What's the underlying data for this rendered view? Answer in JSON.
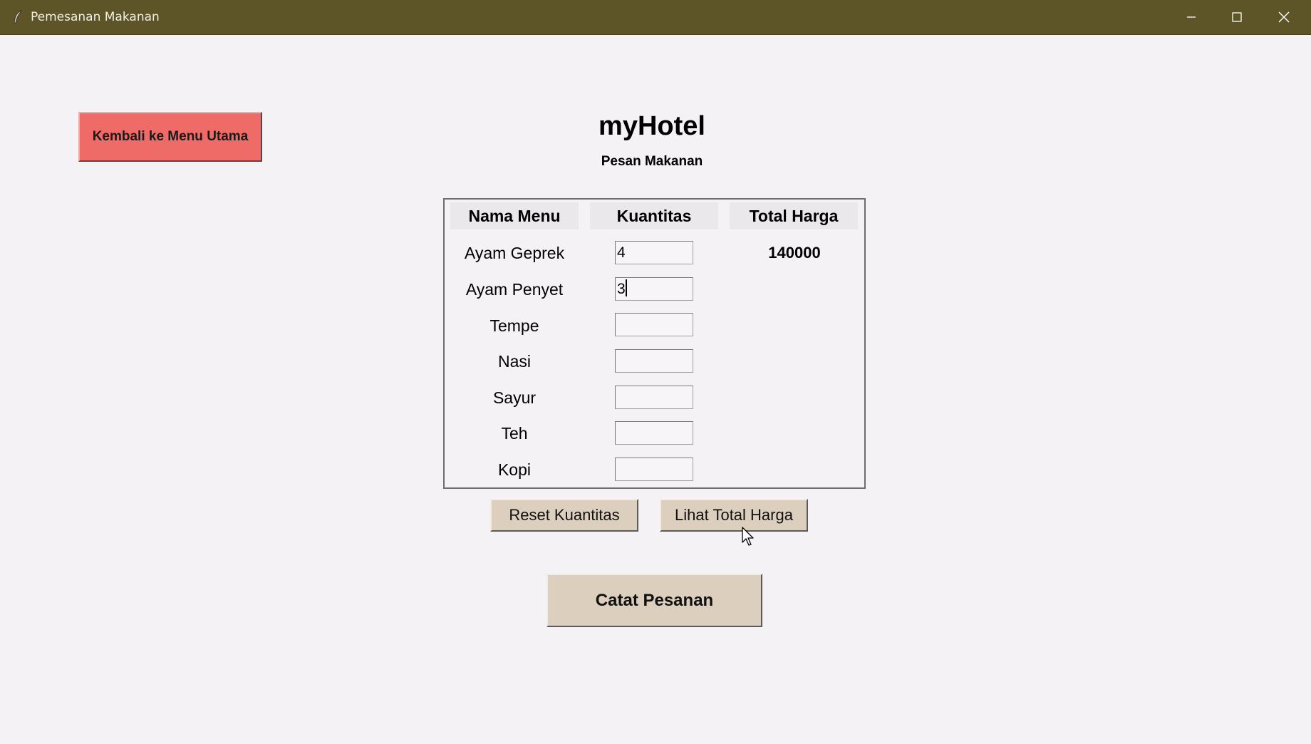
{
  "window": {
    "title": "Pemesanan Makanan",
    "controls": [
      "minimize",
      "maximize",
      "close"
    ],
    "titlebar_color": "#5d5428",
    "icon": "feather-icon"
  },
  "header": {
    "back_button": "Kembali ke Menu Utama",
    "title": "myHotel",
    "subtitle": "Pesan Makanan"
  },
  "order_table": {
    "columns": [
      "Nama Menu",
      "Kuantitas",
      "Total Harga"
    ],
    "rows": [
      {
        "name": "Ayam Geprek",
        "quantity": "4",
        "total": "140000"
      },
      {
        "name": "Ayam Penyet",
        "quantity": "3",
        "total": ""
      },
      {
        "name": "Tempe",
        "quantity": "",
        "total": ""
      },
      {
        "name": "Nasi",
        "quantity": "",
        "total": ""
      },
      {
        "name": "Sayur",
        "quantity": "",
        "total": ""
      },
      {
        "name": "Teh",
        "quantity": "",
        "total": ""
      },
      {
        "name": "Kopi",
        "quantity": "",
        "total": ""
      }
    ]
  },
  "actions": {
    "reset_label": "Reset Kuantitas",
    "total_label": "Lihat Total Harga",
    "save_label": "Catat Pesanan"
  },
  "colors": {
    "back_button_bg": "#ee6b68",
    "button_bg": "#dccfbd",
    "window_bg": "#f5f2f6"
  }
}
